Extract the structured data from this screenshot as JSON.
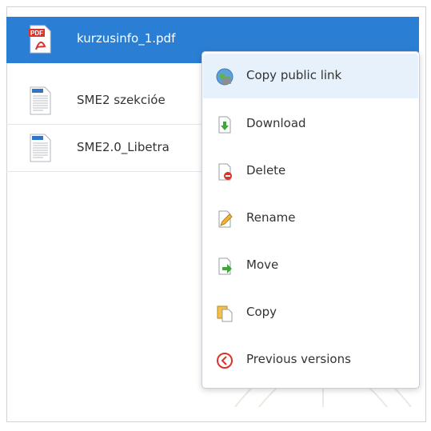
{
  "files": [
    {
      "name": "kurzusinfo_1.pdf",
      "icon": "pdf-file-icon",
      "selected": true
    },
    {
      "name": "SME2 szekcióe",
      "icon": "document-file-icon",
      "selected": false
    },
    {
      "name": "SME2.0_Libetra",
      "icon": "document-file-icon",
      "selected": false
    }
  ],
  "context_menu": {
    "items": [
      {
        "label": "Copy public link",
        "icon": "public-link-icon"
      },
      {
        "label": "Download",
        "icon": "download-icon"
      },
      {
        "label": "Delete",
        "icon": "delete-icon"
      },
      {
        "label": "Rename",
        "icon": "rename-icon"
      },
      {
        "label": "Move",
        "icon": "move-icon"
      },
      {
        "label": "Copy",
        "icon": "copy-icon"
      },
      {
        "label": "Previous versions",
        "icon": "previous-versions-icon"
      }
    ]
  },
  "colors": {
    "selection": "#2a7fd4",
    "menu_highlight": "#e6f1fb",
    "text": "#333333"
  }
}
